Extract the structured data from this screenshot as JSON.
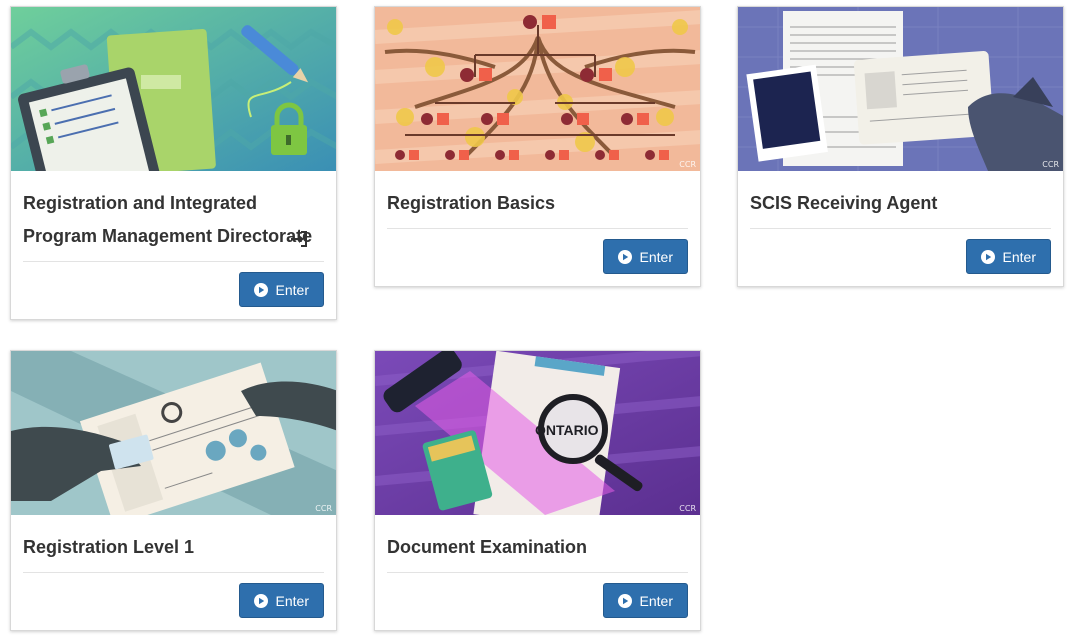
{
  "courses": [
    {
      "title": "Registration and Integrated Program Management Directorate",
      "enter_label": "Enter",
      "has_signin_icon": true,
      "watermark": ""
    },
    {
      "title": "Registration Basics",
      "enter_label": "Enter",
      "has_signin_icon": false,
      "watermark": "CCR"
    },
    {
      "title": "SCIS Receiving Agent",
      "enter_label": "Enter",
      "has_signin_icon": false,
      "watermark": "CCR"
    },
    {
      "title": "Registration Level 1",
      "enter_label": "Enter",
      "has_signin_icon": false,
      "watermark": "CCR"
    },
    {
      "title": "Document Examination",
      "enter_label": "Enter",
      "has_signin_icon": false,
      "watermark": "CCR"
    }
  ],
  "colors": {
    "enter_button": "#2e6fad",
    "title_text": "#333333",
    "card_border": "#d8d8d8"
  },
  "icons": {
    "enter": "play-circle-icon",
    "signin": "sign-in-icon"
  }
}
